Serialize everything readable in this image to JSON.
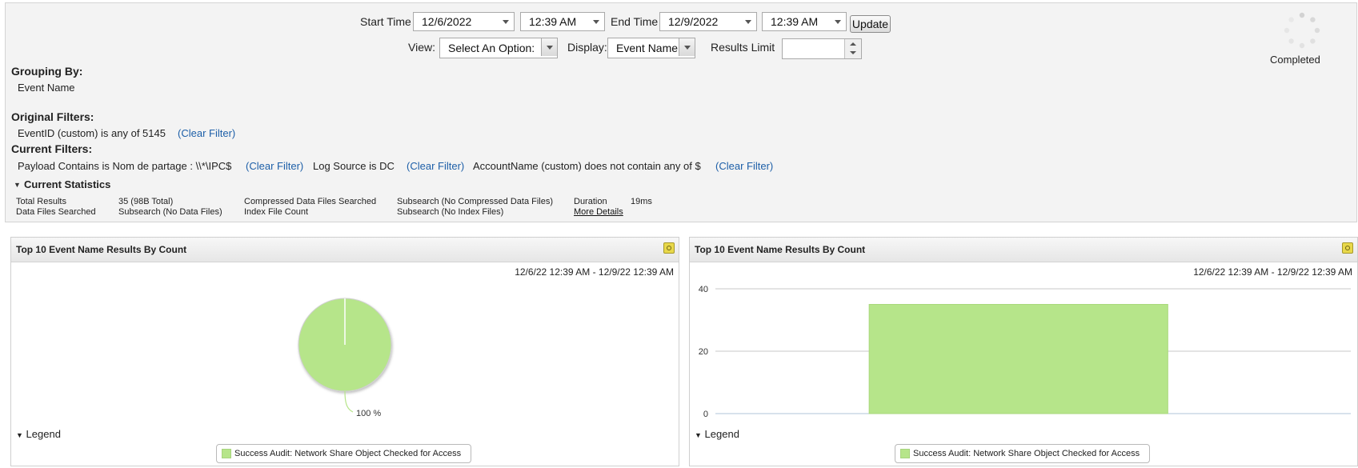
{
  "toolbar": {
    "start_time_label": "Start Time",
    "start_date": "12/6/2022",
    "start_time": "12:39 AM",
    "end_time_label": "End Time",
    "end_date": "12/9/2022",
    "end_time": "12:39 AM",
    "update_label": "Update",
    "view_label": "View:",
    "view_value": "Select An Option:",
    "display_label": "Display:",
    "display_value": "Event Name",
    "results_limit_label": "Results Limit",
    "results_limit_value": ""
  },
  "status": {
    "text": "Completed"
  },
  "grouping": {
    "heading": "Grouping By:",
    "value": "Event Name"
  },
  "original_filters": {
    "heading": "Original Filters:",
    "items": [
      {
        "text": "EventID (custom) is any of 5145",
        "clear": "(Clear Filter)"
      }
    ]
  },
  "current_filters": {
    "heading": "Current Filters:",
    "items": [
      {
        "text": "Payload Contains is Nom de partage : \\\\*\\IPC$",
        "clear": "(Clear Filter)"
      },
      {
        "text": "Log Source is DC",
        "clear": "(Clear Filter)"
      },
      {
        "text": "AccountName (custom) does not contain any of $",
        "clear": "(Clear Filter)"
      }
    ]
  },
  "statistics": {
    "heading": "Current Statistics",
    "rows": [
      [
        "Total Results",
        "35 (98B Total)",
        "Compressed Data Files Searched",
        "Subsearch (No Compressed Data Files)",
        "Duration",
        "19ms"
      ],
      [
        "Data Files Searched",
        "Subsearch (No Data Files)",
        "Index File Count",
        "Subsearch (No Index Files)",
        "More Details",
        ""
      ]
    ]
  },
  "panels": [
    {
      "title": "Top 10 Event Name Results By Count",
      "range": "12/6/22 12:39 AM - 12/9/22 12:39 AM",
      "legend_toggle": "Legend",
      "legend_item": "Success Audit: Network Share Object Checked for Access"
    },
    {
      "title": "Top 10 Event Name Results By Count",
      "range": "12/6/22 12:39 AM - 12/9/22 12:39 AM",
      "legend_toggle": "Legend",
      "legend_item": "Success Audit: Network Share Object Checked for Access"
    }
  ],
  "chart_data": [
    {
      "type": "pie",
      "categories": [
        "Success Audit: Network Share Object Checked for Access"
      ],
      "values": [
        35
      ],
      "labels": [
        "100 %"
      ],
      "color": "#b6e58a"
    },
    {
      "type": "bar",
      "categories": [
        "Success Audit: Network Share Object Checked for Access"
      ],
      "values": [
        35
      ],
      "ylim": [
        0,
        40
      ],
      "yticks": [
        0,
        20,
        40
      ],
      "grid": true,
      "color": "#b6e58a"
    }
  ],
  "colors": {
    "accent_link": "#1d5fa8",
    "bar_fill": "#b6e58a",
    "background": "#f3f3f3"
  },
  "icons": {
    "spinner": "loading-spinner-icon",
    "panel_settings": "panel-settings-icon"
  }
}
